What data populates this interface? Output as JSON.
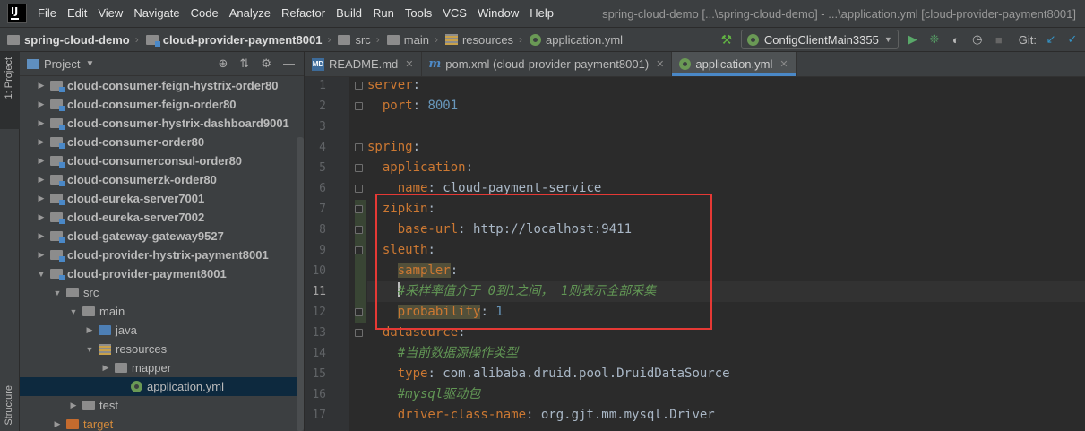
{
  "window": {
    "title": "spring-cloud-demo [...\\spring-cloud-demo] - ...\\application.yml [cloud-provider-payment8001]",
    "logo": "IJ"
  },
  "menu": [
    "File",
    "Edit",
    "View",
    "Navigate",
    "Code",
    "Analyze",
    "Refactor",
    "Build",
    "Run",
    "Tools",
    "VCS",
    "Window",
    "Help"
  ],
  "breadcrumb": [
    {
      "label": "spring-cloud-demo",
      "icon": "project-folder-icon"
    },
    {
      "label": "cloud-provider-payment8001",
      "icon": "module-folder-icon"
    },
    {
      "label": "src",
      "icon": "folder-icon"
    },
    {
      "label": "main",
      "icon": "folder-icon"
    },
    {
      "label": "resources",
      "icon": "resources-folder-icon"
    },
    {
      "label": "application.yml",
      "icon": "spring-config-icon"
    }
  ],
  "toolbar": {
    "run_config": "ConfigClientMain3355",
    "git_label": "Git:"
  },
  "left_strip": {
    "project_tool": "1: Project",
    "structure_tool": "Structure"
  },
  "project_panel": {
    "title": "Project"
  },
  "tree": [
    {
      "label": "cloud-consumer-feign-hystrix-order80",
      "bold": true,
      "expanded": false,
      "depth": 1
    },
    {
      "label": "cloud-consumer-feign-order80",
      "bold": true,
      "expanded": false,
      "depth": 1
    },
    {
      "label": "cloud-consumer-hystrix-dashboard9001",
      "bold": true,
      "expanded": false,
      "depth": 1
    },
    {
      "label": "cloud-consumer-order80",
      "bold": true,
      "expanded": false,
      "depth": 1
    },
    {
      "label": "cloud-consumerconsul-order80",
      "bold": true,
      "expanded": false,
      "depth": 1
    },
    {
      "label": "cloud-consumerzk-order80",
      "bold": true,
      "expanded": false,
      "depth": 1
    },
    {
      "label": "cloud-eureka-server7001",
      "bold": true,
      "expanded": false,
      "depth": 1
    },
    {
      "label": "cloud-eureka-server7002",
      "bold": true,
      "expanded": false,
      "depth": 1
    },
    {
      "label": "cloud-gateway-gateway9527",
      "bold": true,
      "expanded": false,
      "depth": 1
    },
    {
      "label": "cloud-provider-hystrix-payment8001",
      "bold": true,
      "expanded": false,
      "depth": 1
    },
    {
      "label": "cloud-provider-payment8001",
      "bold": true,
      "expanded": true,
      "depth": 1
    },
    {
      "label": "src",
      "bold": false,
      "expanded": true,
      "depth": 2
    },
    {
      "label": "main",
      "bold": false,
      "expanded": true,
      "depth": 3
    },
    {
      "label": "java",
      "bold": false,
      "expanded": false,
      "depth": 4,
      "folder": "blue"
    },
    {
      "label": "resources",
      "bold": false,
      "expanded": true,
      "depth": 4,
      "folder": "resources"
    },
    {
      "label": "mapper",
      "bold": false,
      "expanded": false,
      "depth": 5
    },
    {
      "label": "application.yml",
      "bold": false,
      "leaf": true,
      "depth": 6,
      "selected": true
    },
    {
      "label": "test",
      "bold": false,
      "expanded": false,
      "depth": 3
    },
    {
      "label": "target",
      "bold": false,
      "expanded": false,
      "depth": 2,
      "folder": "orange"
    }
  ],
  "tabs": [
    {
      "label": "README.md",
      "icon": "markdown-icon",
      "active": false
    },
    {
      "label": "pom.xml (cloud-provider-payment8001)",
      "icon": "maven-icon",
      "active": false
    },
    {
      "label": "application.yml",
      "icon": "spring-config-icon",
      "active": true
    }
  ],
  "editor": {
    "current_line": 11,
    "lines": [
      {
        "n": "1",
        "indent": 0,
        "parts": [
          {
            "t": "server",
            "c": "k"
          },
          {
            "t": ":",
            "c": "v"
          }
        ]
      },
      {
        "n": "2",
        "indent": 2,
        "parts": [
          {
            "t": "port",
            "c": "k"
          },
          {
            "t": ": ",
            "c": "v"
          },
          {
            "t": "8001",
            "c": "n"
          }
        ]
      },
      {
        "n": "3",
        "indent": 0,
        "parts": []
      },
      {
        "n": "4",
        "indent": 0,
        "parts": [
          {
            "t": "spring",
            "c": "k"
          },
          {
            "t": ":",
            "c": "v"
          }
        ]
      },
      {
        "n": "5",
        "indent": 2,
        "parts": [
          {
            "t": "application",
            "c": "k"
          },
          {
            "t": ":",
            "c": "v"
          }
        ]
      },
      {
        "n": "6",
        "indent": 4,
        "parts": [
          {
            "t": "name",
            "c": "k"
          },
          {
            "t": ": cloud-payment-service",
            "c": "v"
          }
        ]
      },
      {
        "n": "7",
        "indent": 2,
        "parts": [
          {
            "t": "zipkin",
            "c": "k"
          },
          {
            "t": ":",
            "c": "v"
          }
        ]
      },
      {
        "n": "8",
        "indent": 4,
        "parts": [
          {
            "t": "base-url",
            "c": "k"
          },
          {
            "t": ": http://localhost:9411",
            "c": "v"
          }
        ]
      },
      {
        "n": "9",
        "indent": 2,
        "parts": [
          {
            "t": "sleuth",
            "c": "k"
          },
          {
            "t": ":",
            "c": "v"
          }
        ]
      },
      {
        "n": "10",
        "indent": 4,
        "parts": [
          {
            "t": "sampler",
            "c": "k",
            "hl": true
          },
          {
            "t": ":",
            "c": "v"
          }
        ]
      },
      {
        "n": "11",
        "indent": 4,
        "caret": true,
        "parts": [
          {
            "t": "#采样率值介于 0到1之间， 1则表示全部采集",
            "c": "c"
          }
        ]
      },
      {
        "n": "12",
        "indent": 4,
        "parts": [
          {
            "t": "probability",
            "c": "k",
            "hl": true
          },
          {
            "t": ": ",
            "c": "v"
          },
          {
            "t": "1",
            "c": "n"
          }
        ]
      },
      {
        "n": "13",
        "indent": 2,
        "parts": [
          {
            "t": "datasource",
            "c": "k"
          },
          {
            "t": ":",
            "c": "v"
          }
        ]
      },
      {
        "n": "14",
        "indent": 4,
        "parts": [
          {
            "t": "#当前数据源操作类型",
            "c": "c"
          }
        ]
      },
      {
        "n": "15",
        "indent": 4,
        "parts": [
          {
            "t": "type",
            "c": "k"
          },
          {
            "t": ": com.alibaba.druid.pool.DruidDataSource",
            "c": "v"
          }
        ]
      },
      {
        "n": "16",
        "indent": 4,
        "parts": [
          {
            "t": "#mysql驱动包",
            "c": "c"
          }
        ]
      },
      {
        "n": "17",
        "indent": 4,
        "parts": [
          {
            "t": "driver-class-name",
            "c": "k"
          },
          {
            "t": ": org.gjt.mm.mysql.Driver",
            "c": "v"
          }
        ]
      }
    ],
    "fold_markers": [
      "1",
      "2",
      "4",
      "5",
      "6",
      "7",
      "8",
      "9",
      "12",
      "13"
    ]
  },
  "colors": {
    "keyword": "#cc7832",
    "value": "#a9b7c6",
    "number": "#6897bb",
    "comment": "#629755",
    "annotation_box": "#e53935",
    "selection": "#0d293e"
  }
}
